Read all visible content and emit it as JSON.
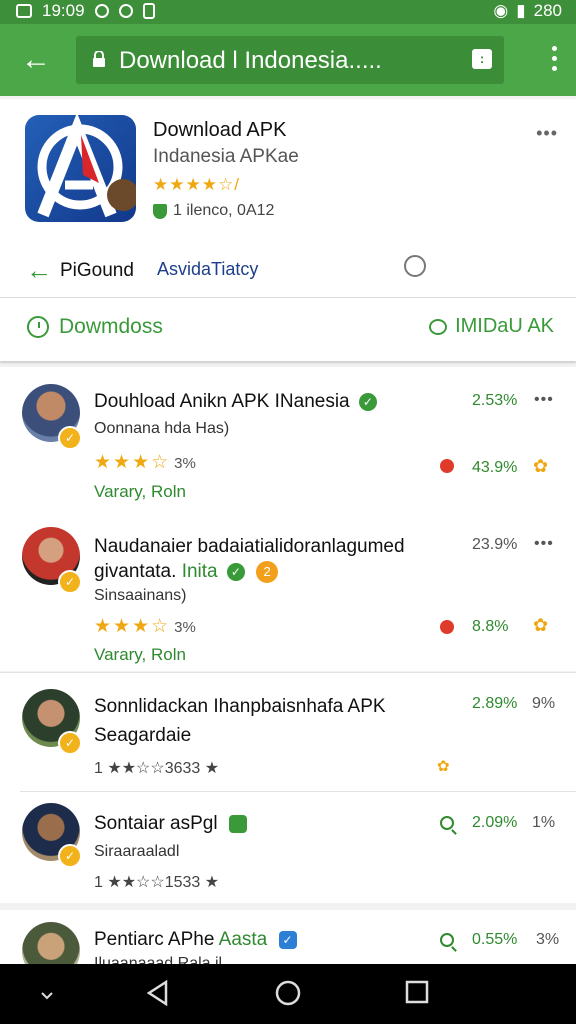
{
  "status_bar": {
    "time": "19:09",
    "right_text": "280"
  },
  "browser": {
    "url": "Download l Indonesia.....",
    "tabs_count": ":"
  },
  "app": {
    "name": "Download APK",
    "developer": "Indanesia  APKae",
    "stars": "★★★★☆/",
    "meta": "1 ilenco, 0A12",
    "back_label": "PiGound",
    "action_link": "AsvidaTiatcy",
    "download_label": "Dowmdoss",
    "ask_label": "IMIDaU AK"
  },
  "reviews": [
    {
      "title": "Douhload Anikn APK INanesia",
      "subtitle": "Oonnana hda Has)",
      "stars": "★★★☆",
      "star_pct": "3%",
      "green": "Varary, Roln",
      "right_pct": "2.53%",
      "right_pct2": "43.9%"
    },
    {
      "title": "Naudanaier badaiatialidoranlagumed",
      "title2": "givantata.",
      "title2_green": "Inita",
      "subtitle": "Sinsaainans)",
      "stars": "★★★☆",
      "star_pct": "3%",
      "green": "Varary, Roln",
      "right_pct": "23.9%",
      "right_pct2": "8.8%"
    },
    {
      "title": "Sonnlidackan Ihanpbaisnhafa APK",
      "title2": "Seagardaie",
      "rating_line": "1 ★★☆☆3633 ★",
      "right_pct": "2.89%",
      "right_pct_gray": "9%"
    },
    {
      "title": "Sontaiar asPgl",
      "subtitle": "Siraaraaladl",
      "rating_line": "1 ★★☆☆1533 ★",
      "right_pct": "2.09%",
      "right_pct_gray": "1%"
    },
    {
      "title": "Pentiarc APhe",
      "title_green": "Aasta",
      "subtitle": "Iluaanaaad Rala il",
      "right_pct": "0.55%",
      "right_pct_gray": "3%"
    }
  ],
  "colors": {
    "green": "#4ca748",
    "dark_green": "#3a9a3a",
    "star": "#f0a812",
    "link_blue": "#1e3f8a"
  }
}
